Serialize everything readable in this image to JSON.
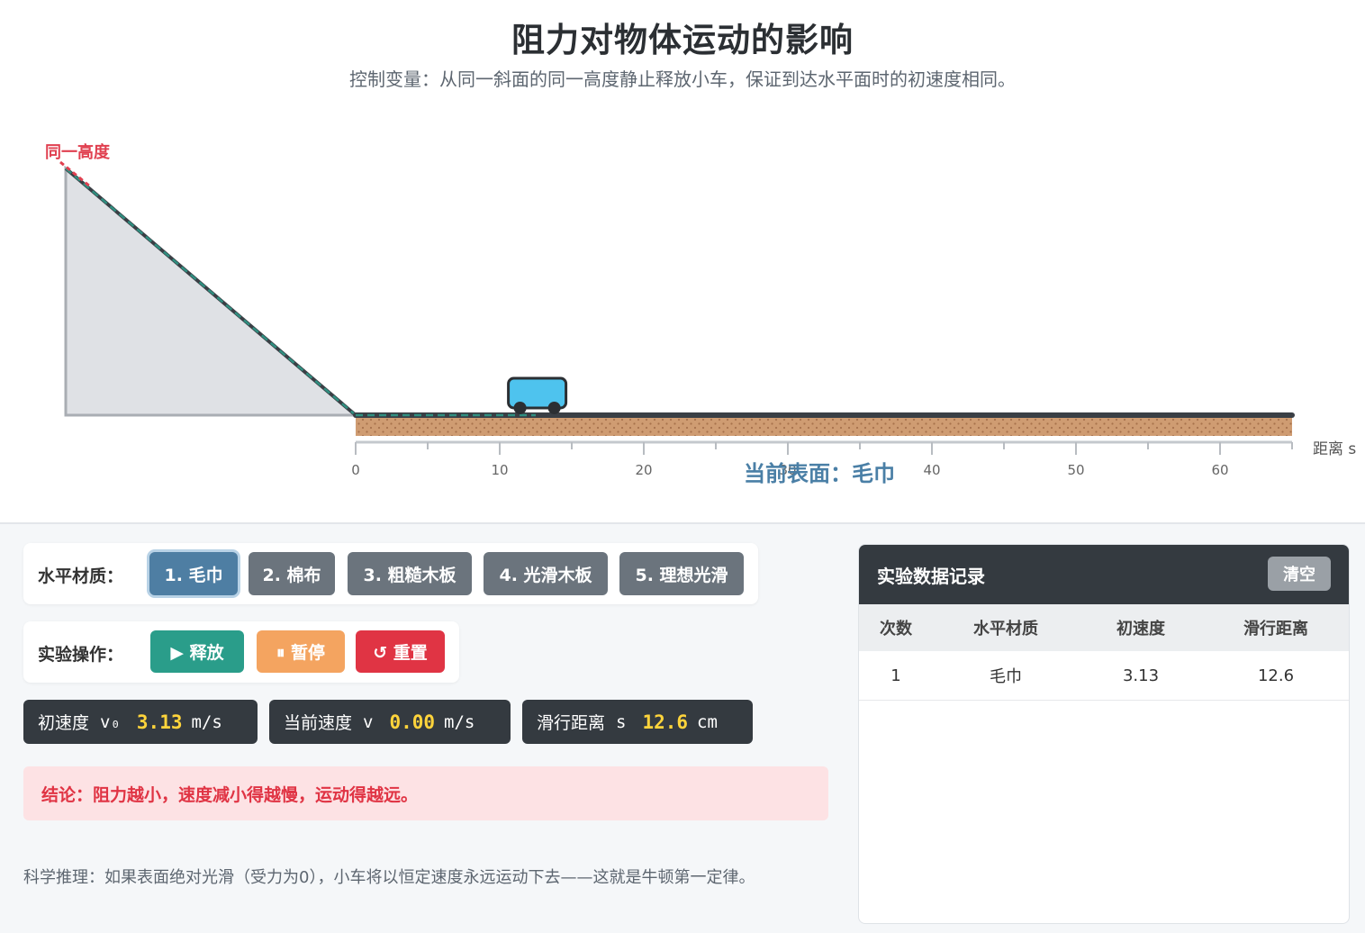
{
  "header": {
    "title": "阻力对物体运动的影响",
    "subtitle": "控制变量：从同一斜面的同一高度静止释放小车，保证到达水平面时的初速度相同。"
  },
  "scene": {
    "height_label": "同一高度",
    "surface_label": "当前表面：毛巾",
    "axis_unit": "距离 s",
    "axis_ticks": [
      "0",
      "10",
      "20",
      "30",
      "40",
      "50",
      "60"
    ],
    "cart_position": 12.6,
    "axis_max": 65,
    "colors": {
      "ramp_fill": "#dfe1e5",
      "ramp_stroke": "#a9adb3",
      "track": "#3a3f45",
      "surface": "#cf9c72",
      "cart": "#4ec3ee",
      "trail": "#2f8f80",
      "height_mark": "#e04050"
    }
  },
  "materials": {
    "label": "水平材质：",
    "options": [
      "1. 毛巾",
      "2. 棉布",
      "3. 粗糙木板",
      "4. 光滑木板",
      "5. 理想光滑"
    ],
    "selected_index": 0
  },
  "operations": {
    "label": "实验操作：",
    "release": "▶ 释放",
    "pause": "⏸ 暂停",
    "reset": "↺ 重置"
  },
  "readouts": {
    "v0_label": "初速度",
    "v0_symbol": "v₀",
    "v0_value": "3.13",
    "v0_unit": "m/s",
    "v_label": "当前速度",
    "v_symbol": "v",
    "v_value": "0.00",
    "v_unit": "m/s",
    "s_label": "滑行距离",
    "s_symbol": "s",
    "s_value": "12.6",
    "s_unit": "cm"
  },
  "conclusion": "结论：阻力越小，速度减小得越慢，运动得越远。",
  "reasoning": "科学推理：如果表面绝对光滑（受力为0），小车将以恒定速度永远运动下去——这就是牛顿第一定律。",
  "records": {
    "title": "实验数据记录",
    "clear": "清空",
    "columns": [
      "次数",
      "水平材质",
      "初速度",
      "滑行距离"
    ],
    "rows": [
      [
        "1",
        "毛巾",
        "3.13",
        "12.6"
      ]
    ]
  }
}
